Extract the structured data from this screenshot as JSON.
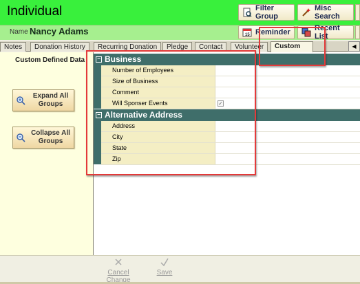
{
  "header": {
    "title": "Individual",
    "buttons": [
      {
        "label": "Filter Group",
        "icon": "filter-page-icon"
      },
      {
        "label": "Misc Search",
        "icon": "search-wand-icon"
      },
      {
        "label": "Reminder",
        "icon": "calendar-icon"
      },
      {
        "label": "Recent List",
        "icon": "recent-list-icon"
      }
    ]
  },
  "name_bar": {
    "label": "Name",
    "value": "Nancy Adams"
  },
  "tabs": [
    {
      "label": "Notes"
    },
    {
      "label": "Donation History"
    },
    {
      "label": "Recurring Donation"
    },
    {
      "label": "Pledge"
    },
    {
      "label": "Contact"
    },
    {
      "label": "Volunteer"
    },
    {
      "label": "Custom",
      "active": true
    }
  ],
  "left_panel": {
    "title": "Custom Defined Data",
    "expand_label": "Expand All Groups",
    "collapse_label": "Collapse All Groups"
  },
  "groups": [
    {
      "name": "Business",
      "fields": [
        {
          "label": "Number of Employees",
          "value": ""
        },
        {
          "label": "Size of Business",
          "value": ""
        },
        {
          "label": "Comment",
          "value": ""
        },
        {
          "label": "Will Sponser Events",
          "value": "checked"
        }
      ]
    },
    {
      "name": "Alternative Address",
      "fields": [
        {
          "label": "Address",
          "value": ""
        },
        {
          "label": "City",
          "value": ""
        },
        {
          "label": "State",
          "value": ""
        },
        {
          "label": "Zip",
          "value": ""
        }
      ]
    }
  ],
  "actions": {
    "cancel_label": "Cancel Change",
    "save_label": "Save"
  },
  "colors": {
    "header": "#39f03c",
    "name_bar": "#a6ef8f",
    "group_header": "#3f6e6a",
    "highlight": "#e43a3a"
  }
}
